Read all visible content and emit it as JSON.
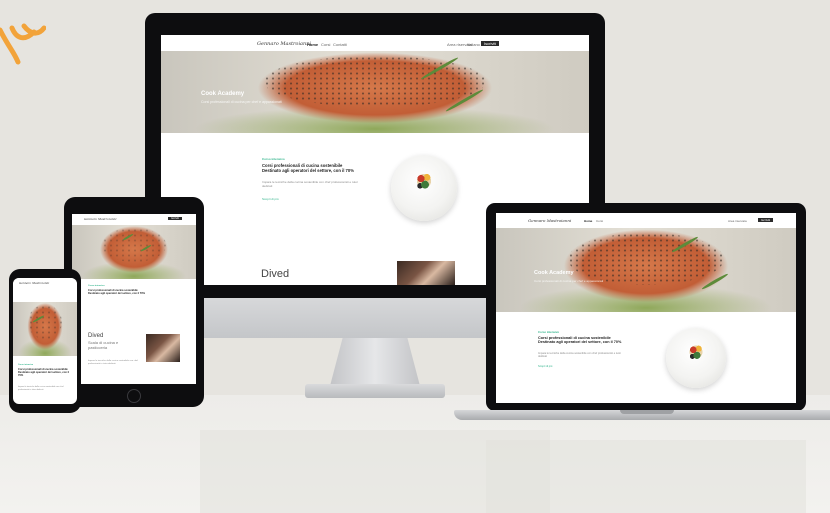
{
  "brand": {
    "logo": "Gennaro Mastroianni"
  },
  "nav": {
    "links": [
      "Home",
      "Corsi",
      "Contatti"
    ],
    "right": [
      "Area riservata",
      "Italiano"
    ],
    "cta": "Iscriviti"
  },
  "hero": {
    "title": "Cook Academy",
    "subtitle": "Corsi professionali di cucina per chef e appassionati"
  },
  "course": {
    "eyebrow": "Corso intensivo",
    "title_line1": "Corsi professionali di cucina sostenibile",
    "title_line2": "Destinato agli operatori del settore, con il 70%",
    "body": "Impara le tecniche della cucina sostenibile con chef professionisti e tutor dedicati",
    "link": "Scopri di più"
  },
  "section": {
    "heading": "Dived",
    "sub_line1": "Scala di cucina e",
    "sub_line2": "pasticceria"
  },
  "colors": {
    "accent": "#2fb38a",
    "background": "#e6e4df",
    "device_frame": "#0d0d0f",
    "brand_mark": "#f2a33a"
  }
}
